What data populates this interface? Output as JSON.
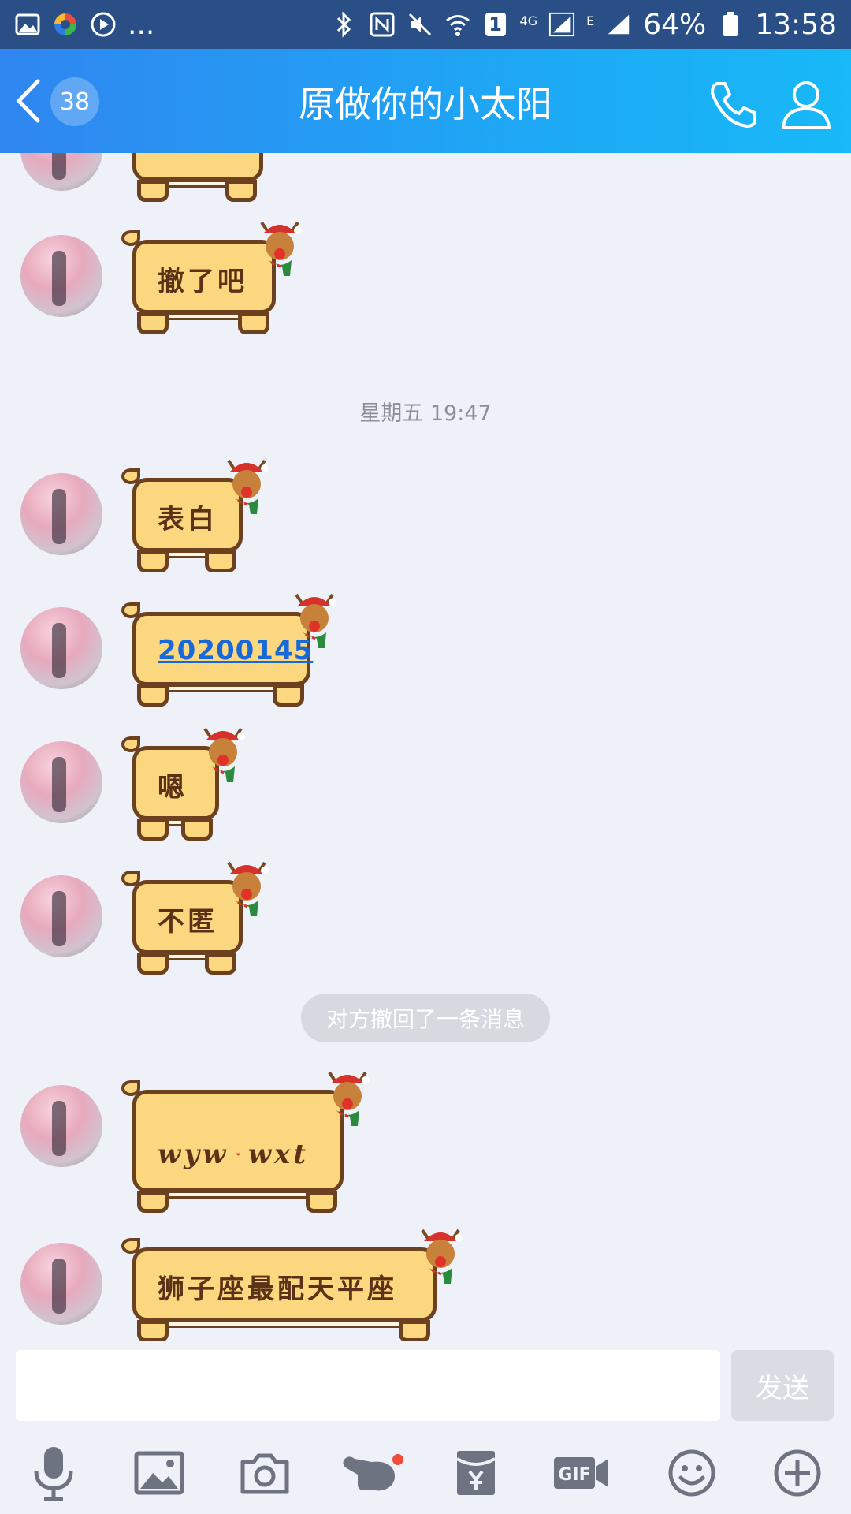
{
  "status_bar": {
    "more": "...",
    "signal_4g": "4G",
    "signal_e": "E",
    "sim_slot": "1",
    "battery": "64%",
    "time": "13:58"
  },
  "header": {
    "unread_count": "38",
    "title": "原做你的小太阳"
  },
  "messages": {
    "m0": {
      "text": ""
    },
    "m1": {
      "text": "撤了吧"
    },
    "timestamp": "星期五 19:47",
    "m2": {
      "text": "表白"
    },
    "m3": {
      "text": "20200145"
    },
    "m4": {
      "text": "嗯"
    },
    "m5": {
      "text": "不匿"
    },
    "system_notice": "对方撤回了一条消息",
    "m6": {
      "left": "wyw",
      "right": "wxt"
    },
    "m7": {
      "text": "狮子座最配天平座"
    }
  },
  "input": {
    "placeholder": "",
    "send_label": "发送"
  },
  "toolbar": {
    "items": [
      "mic-icon",
      "image-icon",
      "camera-icon",
      "poke-icon",
      "red-packet-icon",
      "gif-icon",
      "emoji-icon",
      "plus-icon"
    ]
  },
  "colors": {
    "status_bar": "#2a4f86",
    "header_start": "#2f86f0",
    "header_end": "#18b9f7",
    "background": "#eef1f7",
    "bubble_fill": "#fbd77f",
    "bubble_outline": "#6b4120"
  }
}
